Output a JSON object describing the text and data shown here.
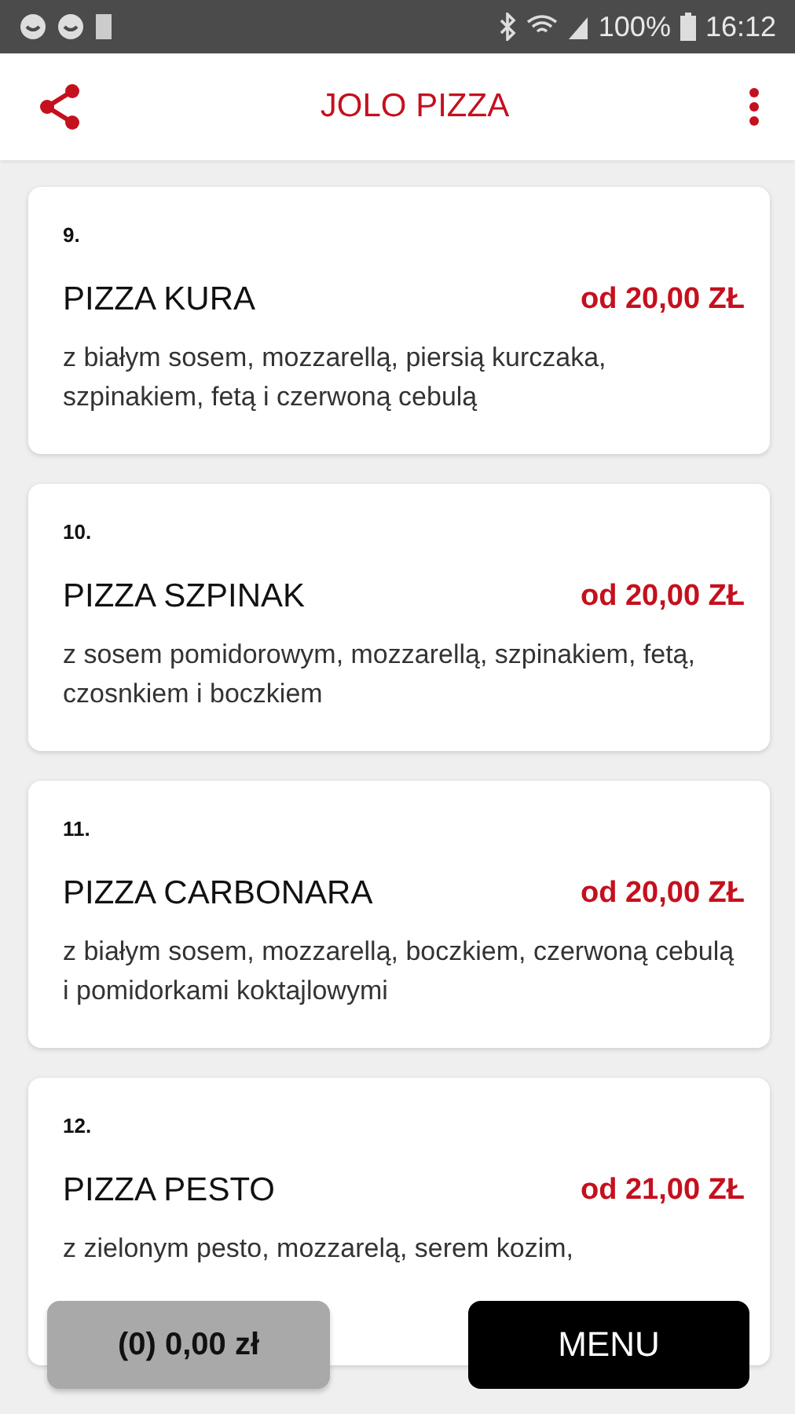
{
  "status_bar": {
    "battery": "100%",
    "time": "16:12"
  },
  "header": {
    "title": "JOLO PIZZA"
  },
  "items": [
    {
      "number": "9.",
      "name": "PIZZA KURA",
      "price": "od 20,00 ZŁ",
      "description": "z białym sosem, mozzarellą, piersią kurczaka, szpinakiem, fetą i czerwoną cebulą"
    },
    {
      "number": "10.",
      "name": "PIZZA SZPINAK",
      "price": "od 20,00 ZŁ",
      "description": "z sosem pomidorowym, mozzarellą, szpinakiem, fetą, czosnkiem i boczkiem"
    },
    {
      "number": "11.",
      "name": "PIZZA CARBONARA",
      "price": "od 20,00 ZŁ",
      "description": "z białym sosem, mozzarellą, boczkiem, czerwoną cebulą i pomidorkami koktajlowymi"
    },
    {
      "number": "12.",
      "name": "PIZZA PESTO",
      "price": "od 21,00 ZŁ",
      "description": "z zielonym pesto, mozzarelą, serem kozim,"
    }
  ],
  "bottom_bar": {
    "cart": "(0) 0,00 zł",
    "menu": "MENU"
  }
}
